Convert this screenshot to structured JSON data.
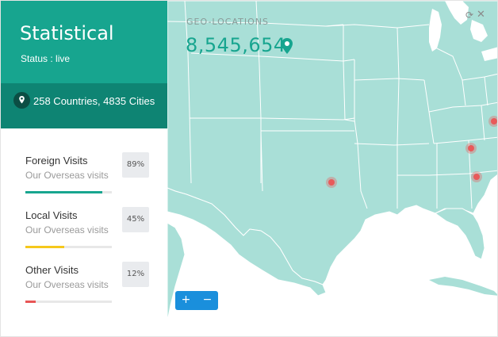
{
  "panel": {
    "title": "Statistical",
    "status": "Status : live",
    "summary": "258 Countries, 4835 Cities"
  },
  "stats": [
    {
      "name": "Foreign Visits",
      "sub": "Our Overseas visits",
      "percent_label": "89%",
      "progress": 0.89,
      "color": "#17a58f"
    },
    {
      "name": "Local Visits",
      "sub": "Our Overseas visits",
      "percent_label": "45%",
      "progress": 0.45,
      "color": "#f5c81c"
    },
    {
      "name": "Other Visits",
      "sub": "Our Overseas visits",
      "percent_label": "12%",
      "progress": 0.12,
      "color": "#e85555"
    }
  ],
  "map": {
    "label": "GEO-LOCATIONS",
    "count": "8,545,654",
    "land_color": "#a9dfd7",
    "marker_color": "#e85a5a",
    "zoom_in": "+",
    "zoom_out": "−",
    "icons": {
      "refresh": "refresh-icon",
      "close": "close-icon",
      "pin": "map-pin-icon"
    }
  }
}
